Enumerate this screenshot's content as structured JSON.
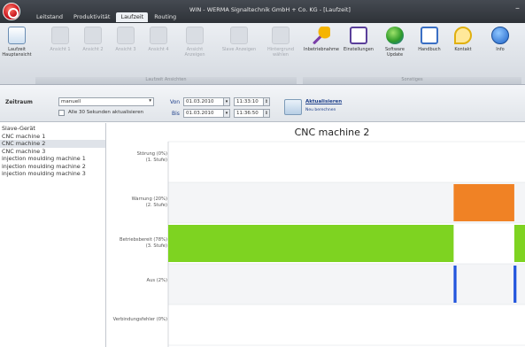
{
  "window": {
    "title": "WIN - WERMA Signaltechnik GmbH + Co. KG - [Laufzeit]",
    "minimize_symbol": "–"
  },
  "tabs": [
    {
      "label": "Leitstand",
      "active": false
    },
    {
      "label": "Produktivität",
      "active": false
    },
    {
      "label": "Laufzeit",
      "active": true
    },
    {
      "label": "Routing",
      "active": false
    }
  ],
  "ribbon": {
    "buttons": [
      {
        "label": "Laufzeit Hauptansicht",
        "enabled": true
      },
      {
        "label": "Ansicht 1",
        "enabled": false
      },
      {
        "label": "Ansicht 2",
        "enabled": false
      },
      {
        "label": "Ansicht 3",
        "enabled": false
      },
      {
        "label": "Ansicht 4",
        "enabled": false
      },
      {
        "label": "Ansicht Anzeigen",
        "enabled": false
      },
      {
        "label": "Slave Anzeigen",
        "enabled": false
      },
      {
        "label": "Hintergrund wählen",
        "enabled": false
      },
      {
        "label": "Inbetriebnahme",
        "enabled": true
      },
      {
        "label": "Einstellungen",
        "enabled": true
      },
      {
        "label": "Software Update",
        "enabled": true
      },
      {
        "label": "Handbuch",
        "enabled": true
      },
      {
        "label": "Kontakt",
        "enabled": true
      },
      {
        "label": "Info",
        "enabled": true
      }
    ],
    "groups": {
      "left": "Laufzeit Ansichten",
      "right": "Sonstiges"
    }
  },
  "filter": {
    "zeitraum_label": "Zeitraum",
    "zeitraum_value": "manuell",
    "auto_refresh_label": "Alle 30 Sekunden aktualisieren",
    "von_label": "Von",
    "von_date": "01.03.2010",
    "von_time": "11:33:10",
    "bis_label": "Bis",
    "bis_date": "01.03.2010",
    "bis_time": "11:36:50",
    "refresh_title": "Aktualisieren",
    "refresh_sub": "Neu berechnen"
  },
  "sidebar": {
    "header": "Slave-Gerät",
    "items": [
      {
        "label": "CNC machine 1",
        "selected": false
      },
      {
        "label": "CNC machine 2",
        "selected": true
      },
      {
        "label": "CNC machine 3",
        "selected": false
      },
      {
        "label": "injection moulding machine 1",
        "selected": false
      },
      {
        "label": "injection moulding machine 2",
        "selected": false
      },
      {
        "label": "injection moulding machine 3",
        "selected": false
      }
    ]
  },
  "chart_data": {
    "type": "timeline",
    "title": "CNC machine 2",
    "rows": [
      {
        "label": "Störung (0%)",
        "sublabel": "(1. Stufe)",
        "color": "#e53935",
        "segments": []
      },
      {
        "label": "Warnung (20%)",
        "sublabel": "(2. Stufe)",
        "color": "#f08225",
        "segments": [
          [
            0.8,
            0.97
          ]
        ]
      },
      {
        "label": "Betriebsbereit (78%)",
        "sublabel": "(3. Stufe)",
        "color": "#7ed321",
        "segments": [
          [
            0.0,
            0.8
          ],
          [
            0.97,
            1.0
          ]
        ]
      },
      {
        "label": "Aus (2%)",
        "sublabel": "",
        "color": "#2255dd",
        "segments": [
          [
            0.8,
            0.808
          ],
          [
            0.968,
            0.976
          ]
        ]
      },
      {
        "label": "Verbindungsfehler (0%)",
        "sublabel": "",
        "color": "#888888",
        "segments": []
      }
    ]
  }
}
